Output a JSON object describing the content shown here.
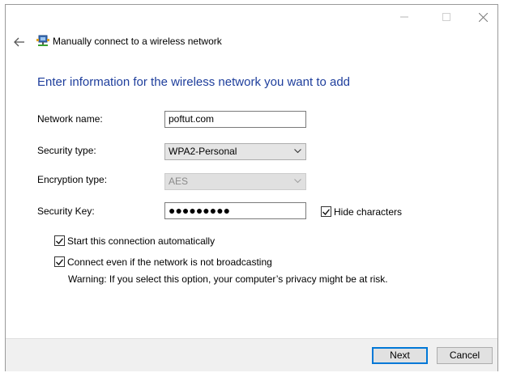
{
  "window": {
    "title": "Manually connect to a wireless network",
    "controls": {
      "minimize": "minimize-icon",
      "maximize": "maximize-icon",
      "close": "close-icon"
    }
  },
  "heading": "Enter information for the wireless network you want to add",
  "form": {
    "network_name": {
      "label": "Network name:",
      "value": "poftut.com"
    },
    "security_type": {
      "label": "Security type:",
      "value": "WPA2-Personal"
    },
    "encryption_type": {
      "label": "Encryption type:",
      "value": "AES",
      "disabled": true
    },
    "security_key": {
      "label": "Security Key:",
      "masked_value": "●●●●●●●●●"
    },
    "hide_characters": {
      "label": "Hide characters",
      "checked": true
    },
    "start_automatically": {
      "label": "Start this connection automatically",
      "checked": true
    },
    "connect_not_broadcasting": {
      "label": "Connect even if the network is not broadcasting",
      "checked": true
    },
    "warning": "Warning: If you select this option, your computer’s privacy might be at risk."
  },
  "footer": {
    "next_label": "Next",
    "cancel_label": "Cancel"
  },
  "colors": {
    "heading": "#1e3e9c",
    "focus_border": "#0078d7",
    "footer_bg": "#f0f0f0"
  }
}
